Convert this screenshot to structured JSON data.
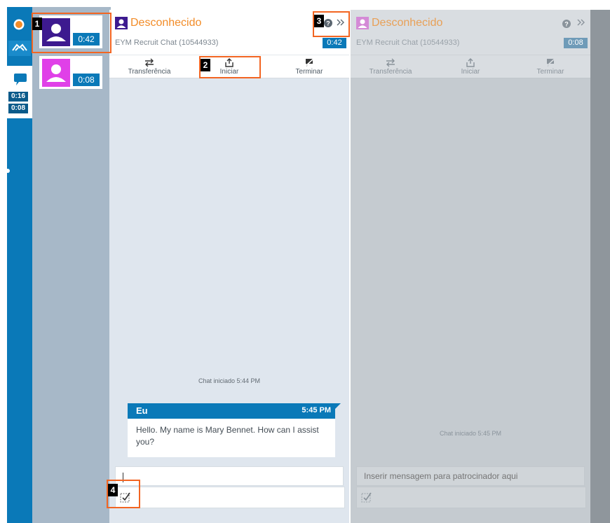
{
  "rail": {
    "timers": [
      "0:16",
      "0:08"
    ]
  },
  "sessions": [
    {
      "timer": "0:42",
      "avatar_color": "#3d1a8f"
    },
    {
      "timer": "0:08",
      "avatar_color": "#e040e8"
    }
  ],
  "panels": [
    {
      "title": "Desconhecido",
      "subtitle": "EYM Recruit Chat (10544933)",
      "timer": "0:42",
      "toolbar": {
        "transfer": "Transferência",
        "start": "Iniciar",
        "end": "Terminar"
      },
      "status": "Chat iniciado 5:44 PM",
      "message": {
        "sender": "Eu",
        "time": "5:45 PM",
        "text": "Hello. My name is Mary Bennet. How can I assist you?"
      },
      "input_value": "",
      "input_placeholder": ""
    },
    {
      "title": "Desconhecido",
      "subtitle": "EYM Recruit Chat (10544933)",
      "timer": "0:08",
      "toolbar": {
        "transfer": "Transferência",
        "start": "Iniciar",
        "end": "Terminar"
      },
      "status": "Chat iniciado 5:45 PM",
      "input_placeholder": "Inserir mensagem para patrocinador aqui"
    }
  ],
  "callouts": [
    "1",
    "2",
    "3",
    "4"
  ],
  "colors": {
    "accent": "#0a79b8",
    "title": "#f28c28",
    "highlight": "#f26522"
  }
}
